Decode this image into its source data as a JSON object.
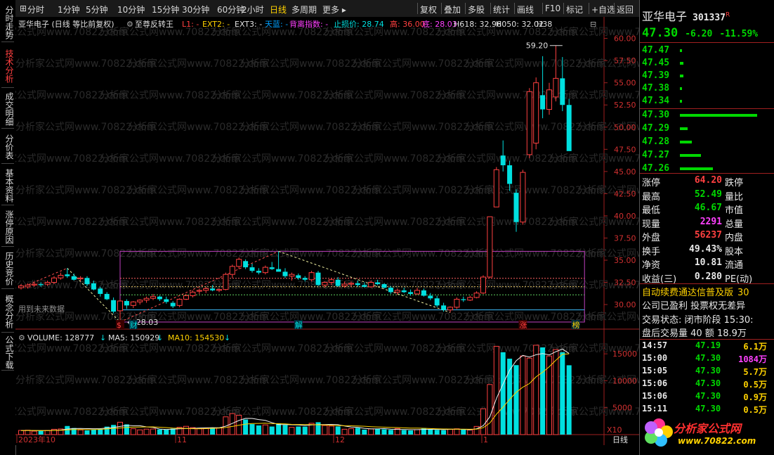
{
  "left_tabs": [
    {
      "label": "分时走势",
      "active": false
    },
    {
      "label": "技术分析",
      "active": true
    },
    {
      "label": "成交明细",
      "active": false
    },
    {
      "label": "分价表",
      "active": false
    },
    {
      "label": "基本资料",
      "active": false
    },
    {
      "label": "涨停原因",
      "active": false
    },
    {
      "label": "历史竞价",
      "active": false
    },
    {
      "label": "概念分析",
      "active": false
    },
    {
      "label": "公式下载",
      "active": false
    }
  ],
  "top_tabs": [
    "分时",
    "1分钟",
    "5分钟",
    "10分钟",
    "15分钟",
    "30分钟",
    "60分钟",
    "2小时",
    "日线",
    "多周期",
    "更多 ▸"
  ],
  "active_tab": "日线",
  "top_tools": [
    "复权",
    "叠加",
    "多股",
    "统计",
    "画线",
    "F10",
    "标记",
    "+自选",
    "返回"
  ],
  "info_line": {
    "title": "亚华电子 (日线 等比前复权)",
    "indicator": "至尊反转王",
    "l1": "L1: -",
    "ext2": "EXT2: -",
    "ext3": "EXT3: -",
    "tianlan": "天蓝: -",
    "beili": "背离指数: -",
    "stop": "止损价: 28.74",
    "high": "高: 36.00",
    "low": "底: 28.03",
    "h618": "H618: 32.96",
    "h050": "H050: 32.02",
    "h38": "H38"
  },
  "price_axis": [
    "60.00",
    "57.50",
    "55.00",
    "52.50",
    "50.00",
    "47.50",
    "45.00",
    "42.50",
    "40.00",
    "37.50",
    "35.00",
    "32.50",
    "30.00"
  ],
  "annotations": {
    "high": "59.20",
    "low": "28.03",
    "future": "用到未来数据"
  },
  "markers": [
    {
      "text": "$",
      "color": "#ff4040"
    },
    {
      "text": "财",
      "color": "#00e0e0"
    },
    {
      "text": "解",
      "color": "#00e0e0"
    },
    {
      "text": "涨",
      "color": "#ff4040"
    },
    {
      "text": "榜",
      "color": "#ffd200"
    }
  ],
  "volume_line": {
    "label": "VOLUME: 128777",
    "ma5": "MA5: 150929",
    "ma10": "MA10: 154530"
  },
  "volume_axis": [
    "15000",
    "10000",
    "5000"
  ],
  "volume_unit": "X10",
  "date_labels": [
    "2023年10",
    "11",
    "12",
    "1"
  ],
  "bottom_right": "日线",
  "watermark": "分析家公式网www.70822.com",
  "chart_data": {
    "type": "candlestick",
    "ylim": [
      28.5,
      61.0
    ],
    "ohlc": [
      [
        31.9,
        32.3,
        31.7,
        32.1
      ],
      [
        32.0,
        32.4,
        31.8,
        32.2
      ],
      [
        32.2,
        32.6,
        32.0,
        32.3
      ],
      [
        32.3,
        32.5,
        32.0,
        32.2
      ],
      [
        32.3,
        32.7,
        32.1,
        32.5
      ],
      [
        32.5,
        33.2,
        32.3,
        33.0
      ],
      [
        33.0,
        33.6,
        32.8,
        33.3
      ],
      [
        33.4,
        34.1,
        33.0,
        33.2
      ],
      [
        33.2,
        33.5,
        32.7,
        32.8
      ],
      [
        32.9,
        33.2,
        32.6,
        33.0
      ],
      [
        33.0,
        33.2,
        32.1,
        32.3
      ],
      [
        32.4,
        32.7,
        31.6,
        31.7
      ],
      [
        31.8,
        32.0,
        30.9,
        31.2
      ],
      [
        31.2,
        31.4,
        30.5,
        30.6
      ],
      [
        30.5,
        30.8,
        29.0,
        29.2
      ],
      [
        29.3,
        30.6,
        28.0,
        30.4
      ],
      [
        30.4,
        30.6,
        29.5,
        29.9
      ],
      [
        29.9,
        30.4,
        29.6,
        30.3
      ],
      [
        30.3,
        30.6,
        30.0,
        30.5
      ],
      [
        30.5,
        30.9,
        30.2,
        30.7
      ],
      [
        30.7,
        31.2,
        30.5,
        30.9
      ],
      [
        30.9,
        31.0,
        30.4,
        30.6
      ],
      [
        30.6,
        30.9,
        30.1,
        30.3
      ],
      [
        30.2,
        30.4,
        29.6,
        29.8
      ],
      [
        29.9,
        30.7,
        29.7,
        30.6
      ],
      [
        30.6,
        31.2,
        30.5,
        31.0
      ],
      [
        31.0,
        31.6,
        30.8,
        31.4
      ],
      [
        31.5,
        31.8,
        31.2,
        31.6
      ],
      [
        31.6,
        32.0,
        31.3,
        31.8
      ],
      [
        31.8,
        32.2,
        31.5,
        31.6
      ],
      [
        31.6,
        31.8,
        31.4,
        31.7
      ],
      [
        31.7,
        33.6,
        31.6,
        33.4
      ],
      [
        33.4,
        34.5,
        33.0,
        34.3
      ],
      [
        34.3,
        35.3,
        34.0,
        35.1
      ],
      [
        34.9,
        35.1,
        34.0,
        34.2
      ],
      [
        34.2,
        34.6,
        33.6,
        33.8
      ],
      [
        33.8,
        34.1,
        33.4,
        33.6
      ],
      [
        33.6,
        34.4,
        33.4,
        34.2
      ],
      [
        34.2,
        34.8,
        33.9,
        34.0
      ],
      [
        34.0,
        36.0,
        33.8,
        33.7
      ],
      [
        33.7,
        34.1,
        33.0,
        33.2
      ],
      [
        33.2,
        33.6,
        32.7,
        33.4
      ],
      [
        33.3,
        33.5,
        32.8,
        33.0
      ],
      [
        33.0,
        33.2,
        32.6,
        32.8
      ],
      [
        32.8,
        33.8,
        32.6,
        33.6
      ],
      [
        33.6,
        33.8,
        32.1,
        32.2
      ],
      [
        32.2,
        32.6,
        31.9,
        32.5
      ],
      [
        32.5,
        33.0,
        32.2,
        32.8
      ],
      [
        32.8,
        33.1,
        32.0,
        32.1
      ],
      [
        32.1,
        32.6,
        31.9,
        32.3
      ],
      [
        32.3,
        32.6,
        32.0,
        32.4
      ],
      [
        32.4,
        32.7,
        32.0,
        32.2
      ],
      [
        32.2,
        32.5,
        31.9,
        32.0
      ],
      [
        32.0,
        32.7,
        31.9,
        32.5
      ],
      [
        32.5,
        32.8,
        32.2,
        32.3
      ],
      [
        32.3,
        32.4,
        31.8,
        31.9
      ],
      [
        31.9,
        32.1,
        31.2,
        31.4
      ],
      [
        31.4,
        31.8,
        31.1,
        31.6
      ],
      [
        31.6,
        31.9,
        31.3,
        31.4
      ],
      [
        31.4,
        31.7,
        31.0,
        31.2
      ],
      [
        31.2,
        31.9,
        31.1,
        31.6
      ],
      [
        31.6,
        31.8,
        30.9,
        31.0
      ],
      [
        31.0,
        31.3,
        30.5,
        30.7
      ],
      [
        30.7,
        31.0,
        29.7,
        29.9
      ],
      [
        29.9,
        30.2,
        29.2,
        29.4
      ],
      [
        29.4,
        29.8,
        29.1,
        29.7
      ],
      [
        29.7,
        30.8,
        29.5,
        30.6
      ],
      [
        30.6,
        30.9,
        30.3,
        30.5
      ],
      [
        30.5,
        31.0,
        30.4,
        30.8
      ],
      [
        30.8,
        31.5,
        30.7,
        31.3
      ],
      [
        31.3,
        33.3,
        31.2,
        33.1
      ],
      [
        33.1,
        39.9,
        33.0,
        39.9
      ],
      [
        41.0,
        45.5,
        41.0,
        45.2
      ],
      [
        46.8,
        48.5,
        45.0,
        45.7
      ],
      [
        45.7,
        46.2,
        42.8,
        43.6
      ],
      [
        42.6,
        43.0,
        38.2,
        39.3
      ],
      [
        39.3,
        45.2,
        39.0,
        44.9
      ],
      [
        46.9,
        54.4,
        46.5,
        54.0
      ],
      [
        48.2,
        55.6,
        47.5,
        55.0
      ],
      [
        53.6,
        58.0,
        51.0,
        52.0
      ],
      [
        52.0,
        55.0,
        51.4,
        54.2
      ],
      [
        53.4,
        59.2,
        52.9,
        55.5
      ],
      [
        55.5,
        57.9,
        51.8,
        52.5
      ],
      [
        52.5,
        53.2,
        47.5,
        47.3
      ]
    ],
    "volume": [
      780,
      820,
      640,
      700,
      760,
      990,
      1050,
      1600,
      1220,
      870,
      780,
      940,
      1050,
      1480,
      1800,
      2300,
      1900,
      1100,
      880,
      1020,
      1040,
      940,
      980,
      1120,
      1360,
      1540,
      1300,
      1150,
      1180,
      1240,
      1270,
      3300,
      3900,
      3600,
      2800,
      1950,
      1700,
      1800,
      1500,
      2100,
      1800,
      1350,
      1500,
      1480,
      2100,
      2300,
      1700,
      1600,
      1520,
      1000,
      1100,
      1260,
      920,
      1060,
      1120,
      980,
      880,
      1120,
      840,
      780,
      920,
      1220,
      990,
      880,
      820,
      960,
      1080,
      1000,
      860,
      1520,
      4800,
      9300,
      16400,
      15300,
      14100,
      12900,
      14600,
      14200,
      16600,
      16200,
      14600,
      15800,
      15300,
      12877
    ],
    "ma5": [
      760,
      770,
      760,
      745,
      745,
      780,
      830,
      1028,
      1124,
      1146,
      1104,
      1096,
      1112,
      1226,
      1344,
      1514,
      1706,
      1646,
      1652,
      1432,
      1328,
      1036,
      956,
      1010,
      1082,
      1152,
      1166,
      1222,
      1248,
      1290,
      1256,
      1572,
      2070,
      2626,
      3016,
      3010,
      2796,
      2644,
      2226,
      1870,
      1870,
      1822,
      1794,
      1692,
      1804,
      1870,
      1852,
      1896,
      1844,
      1600,
      1400,
      1356,
      1162,
      1060,
      1060,
      1120,
      1000,
      970,
      940,
      932,
      910,
      976,
      974,
      962,
      928,
      992,
      988,
      982,
      898,
      1084,
      1660,
      3310,
      6710,
      9390,
      11960,
      13720,
      14720,
      14400,
      14840,
      15060,
      14800,
      15400,
      15900,
      15075
    ],
    "ma10": [
      760,
      765,
      765,
      760,
      760,
      770,
      800,
      880,
      940,
      955,
      935,
      930,
      980,
      1060,
      1140,
      1230,
      1345,
      1380,
      1405,
      1420,
      1440,
      1370,
      1300,
      1220,
      1180,
      1140,
      1100,
      1090,
      1115,
      1160,
      1210,
      1320,
      1520,
      1750,
      1950,
      2050,
      2080,
      2120,
      2040,
      2020,
      2000,
      1890,
      1880,
      1870,
      1850,
      1820,
      1790,
      1740,
      1700,
      1650,
      1630,
      1600,
      1560,
      1480,
      1420,
      1380,
      1330,
      1310,
      1250,
      1220,
      1200,
      1180,
      1120,
      1080,
      1040,
      1030,
      1010,
      1000,
      990,
      1010,
      1290,
      2160,
      3800,
      5110,
      6540,
      7860,
      8820,
      9480,
      10720,
      11600,
      12600,
      13800,
      14900,
      15000
    ],
    "vol_ylim": [
      0,
      17500
    ]
  },
  "right_panel": {
    "stock_name": "亚华电子",
    "stock_code": "301337",
    "code_badge": "R",
    "price": "47.30",
    "change": "-6.20",
    "change_pct": "-11.59%",
    "asks": [
      {
        "p": "47.47",
        "v": 0.02
      },
      {
        "p": "47.45",
        "v": 0.03
      },
      {
        "p": "47.39",
        "v": 0.03
      },
      {
        "p": "47.38",
        "v": 0.02
      },
      {
        "p": "47.34",
        "v": 0.02
      }
    ],
    "bids": [
      {
        "p": "47.30",
        "v": 1.0
      },
      {
        "p": "47.29",
        "v": 0.1
      },
      {
        "p": "47.28",
        "v": 0.15
      },
      {
        "p": "47.27",
        "v": 0.27
      },
      {
        "p": "47.26",
        "v": 0.43
      }
    ],
    "stats": [
      {
        "l": "涨停",
        "v": "64.20",
        "c": "red",
        "r": "跌停"
      },
      {
        "l": "最高",
        "v": "52.49",
        "c": "green",
        "r": "量比"
      },
      {
        "l": "最低",
        "v": "46.67",
        "c": "green",
        "r": "市值"
      },
      {
        "l": "现量",
        "v": "2291",
        "c": "magenta",
        "r": "总量"
      },
      {
        "l": "外盘",
        "v": "56237",
        "c": "red",
        "r": "内盘"
      },
      {
        "l": "换手",
        "v": "49.43%",
        "c": "white",
        "r": "股本"
      },
      {
        "l": "净资",
        "v": "10.81",
        "c": "white",
        "r": "流通"
      },
      {
        "l": "收益(三)",
        "v": "0.280",
        "c": "white",
        "r": "PE(动)"
      }
    ],
    "notice1": "自动续费通达信普及版",
    "notice1_tail": "30",
    "notice2": "公司已盈利 投票权无差异",
    "notice3": "交易状态: 闭市阶段 15:30:",
    "notice4": "盘后交易量 40 额 18.9万",
    "ticks": [
      {
        "t": "14:57",
        "p": "47.19",
        "v": "6.1万",
        "vc": "yellow"
      },
      {
        "t": "15:00",
        "p": "47.30",
        "v": "1084万",
        "vc": "magenta"
      },
      {
        "t": "15:05",
        "p": "47.30",
        "v": "5.7万",
        "vc": "yellow"
      },
      {
        "t": "15:06",
        "p": "47.30",
        "v": "0.5万",
        "vc": "yellow"
      },
      {
        "t": "15:06",
        "p": "47.30",
        "v": "0.9万",
        "vc": "yellow"
      },
      {
        "t": "15:11",
        "p": "47.30",
        "v": "0.5万",
        "vc": "yellow"
      }
    ],
    "logo_text": "分析家公式网",
    "logo_url": "www.70822.com"
  }
}
